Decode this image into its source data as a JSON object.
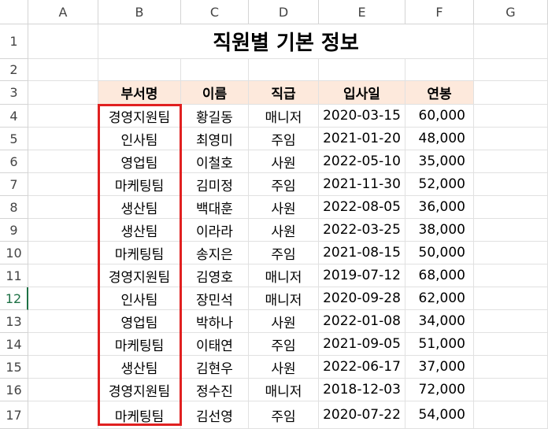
{
  "columns": [
    "A",
    "B",
    "C",
    "D",
    "E",
    "F",
    "G"
  ],
  "rows": [
    "1",
    "2",
    "3",
    "4",
    "5",
    "6",
    "7",
    "8",
    "9",
    "10",
    "11",
    "12",
    "13",
    "14",
    "15",
    "16",
    "17"
  ],
  "active_row": "12",
  "title": "직원별 기본 정보",
  "headers": [
    "부서명",
    "이름",
    "직급",
    "입사일",
    "연봉"
  ],
  "records": [
    [
      "경영지원팀",
      "황길동",
      "매니저",
      "2020-03-15",
      "60,000"
    ],
    [
      "인사팀",
      "최영미",
      "주임",
      "2021-01-20",
      "48,000"
    ],
    [
      "영업팀",
      "이철호",
      "사원",
      "2022-05-10",
      "35,000"
    ],
    [
      "마케팅팀",
      "김미정",
      "주임",
      "2021-11-30",
      "52,000"
    ],
    [
      "생산팀",
      "백대훈",
      "사원",
      "2022-08-05",
      "36,000"
    ],
    [
      "생산팀",
      "이라라",
      "사원",
      "2022-03-25",
      "38,000"
    ],
    [
      "마케팅팀",
      "송지은",
      "주임",
      "2021-08-15",
      "50,000"
    ],
    [
      "경영지원팀",
      "김영호",
      "매니저",
      "2019-07-12",
      "68,000"
    ],
    [
      "인사팀",
      "장민석",
      "매니저",
      "2020-09-28",
      "62,000"
    ],
    [
      "영업팀",
      "박하나",
      "사원",
      "2022-01-08",
      "34,000"
    ],
    [
      "마케팅팀",
      "이태연",
      "주임",
      "2021-09-05",
      "51,000"
    ],
    [
      "생산팀",
      "김현우",
      "사원",
      "2022-06-17",
      "37,000"
    ],
    [
      "경영지원팀",
      "정수진",
      "매니저",
      "2018-12-03",
      "72,000"
    ],
    [
      "마케팅팀",
      "김선영",
      "주임",
      "2020-07-22",
      "54,000"
    ]
  ],
  "colors": {
    "header_fill": "#fde9dc",
    "highlight_border": "#e02020",
    "active_row_header": "#1e7145"
  }
}
